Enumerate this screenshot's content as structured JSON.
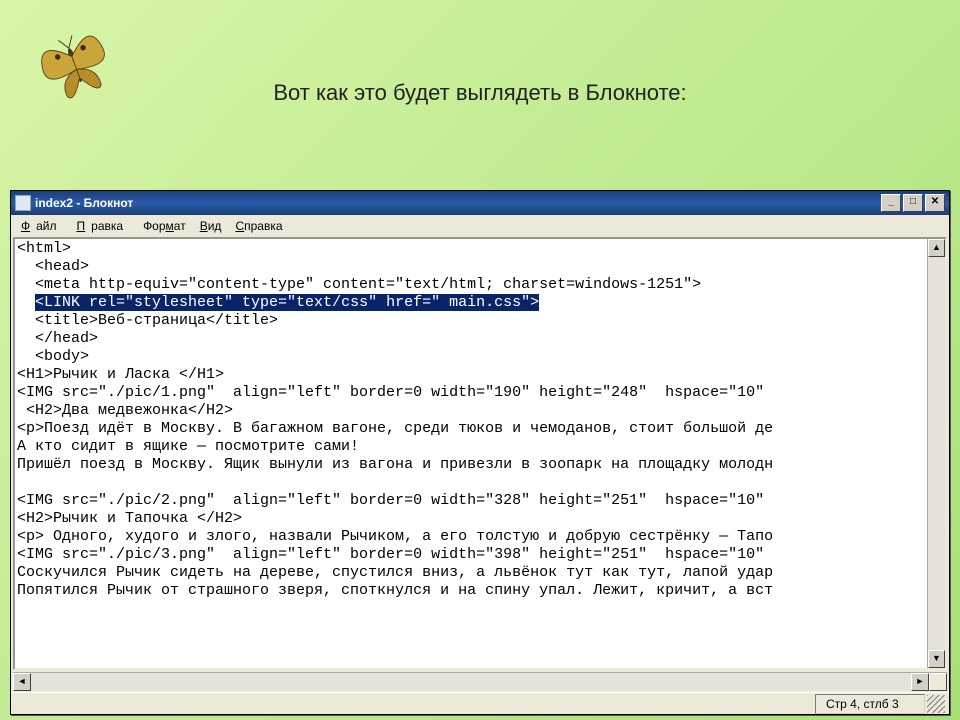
{
  "slide": {
    "caption": "Вот как это будет выглядеть в Блокноте:"
  },
  "window": {
    "title": "index2 - Блокнот"
  },
  "menu": {
    "file": "Файл",
    "edit": "Правка",
    "format": "Формат",
    "view": "Вид",
    "help": "Справка"
  },
  "status": {
    "pos": "Стр 4, стлб 3"
  },
  "code": {
    "l1": "<html>",
    "l2": "  <head>",
    "l3": "  <meta http-equiv=\"content-type\" content=\"text/html; charset=windows-1251\">",
    "l4a": "  ",
    "l4sel": "<LINK rel=\"stylesheet\" type=\"text/css\" href=\" main.css\">",
    "l5": "  <title>Веб-страница</title>",
    "l6": "  </head>",
    "l7": "  <body>",
    "l8": "<H1>Рычик и Ласка </H1>",
    "l9": "<IMG src=\"./pic/1.png\"  align=\"left\" border=0 width=\"190\" height=\"248\"  hspace=\"10\"",
    "l10": " <H2>Два медвежонка</H2>",
    "l11": "<p>Поезд идёт в Москву. В багажном вагоне, среди тюков и чемоданов, стоит большой де",
    "l12": "А кто сидит в ящике — посмотрите сами!",
    "l13": "Пришёл поезд в Москву. Ящик вынули из вагона и привезли в зоопарк на площадку молодн",
    "l14": "",
    "l15": "<IMG src=\"./pic/2.png\"  align=\"left\" border=0 width=\"328\" height=\"251\"  hspace=\"10\"",
    "l16": "<H2>Рычик и Тапочка </H2>",
    "l17": "<p> Одного, худого и злого, назвали Рычиком, а его толстую и добрую сестрёнку — Тапо",
    "l18": "<IMG src=\"./pic/3.png\"  align=\"left\" border=0 width=\"398\" height=\"251\"  hspace=\"10\"",
    "l19": "Соскучился Рычик сидеть на дереве, спустился вниз, а львёнок тут как тут, лапой удар",
    "l20": "Попятился Рычик от страшного зверя, споткнулся и на спину упал. Лежит, кричит, а вст"
  }
}
